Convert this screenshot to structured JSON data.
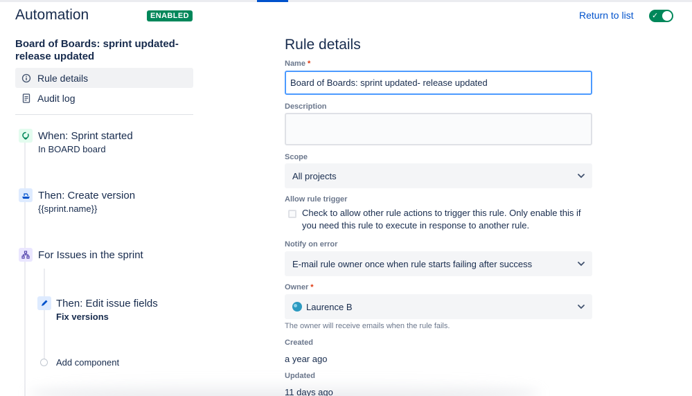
{
  "header": {
    "title": "Automation",
    "status_badge": "ENABLED",
    "return_link": "Return to list",
    "toggle_on": true
  },
  "sidebar": {
    "rule_name": "Board of Boards: sprint updated- release updated",
    "nav": [
      {
        "label": "Rule details",
        "icon": "info-icon",
        "active": true
      },
      {
        "label": "Audit log",
        "icon": "document-icon",
        "active": false
      }
    ],
    "components": [
      {
        "title": "When: Sprint started",
        "subtitle": "In BOARD board",
        "icon": "trigger-icon",
        "icon_color": "#00875a"
      },
      {
        "title": "Then: Create version",
        "subtitle": "{{sprint.name}}",
        "icon": "ship-icon",
        "icon_color": "#0052cc"
      },
      {
        "title": "For Issues in the sprint",
        "subtitle": "",
        "icon": "branch-icon",
        "icon_color": "#5243aa"
      },
      {
        "title": "Then: Edit issue fields",
        "subtitle": "Fix versions",
        "icon": "pencil-icon",
        "icon_color": "#0052cc"
      }
    ],
    "add_component": "Add component"
  },
  "details": {
    "title": "Rule details",
    "name_label": "Name",
    "name_value": "Board of Boards: sprint updated- release updated",
    "description_label": "Description",
    "description_value": "",
    "scope_label": "Scope",
    "scope_value": "All projects",
    "allow_trigger_label": "Allow rule trigger",
    "allow_trigger_text": "Check to allow other rule actions to trigger this rule. Only enable this if you need this rule to execute in response to another rule.",
    "allow_trigger_checked": false,
    "notify_label": "Notify on error",
    "notify_value": "E-mail rule owner once when rule starts failing after success",
    "owner_label": "Owner",
    "owner_value": "Laurence B",
    "owner_helper": "The owner will receive emails when the rule fails.",
    "created_label": "Created",
    "created_value": "a year ago",
    "updated_label": "Updated",
    "updated_value": "11 days ago"
  },
  "colors": {
    "accent": "#0052cc",
    "success": "#00875a",
    "required": "#de350b"
  }
}
